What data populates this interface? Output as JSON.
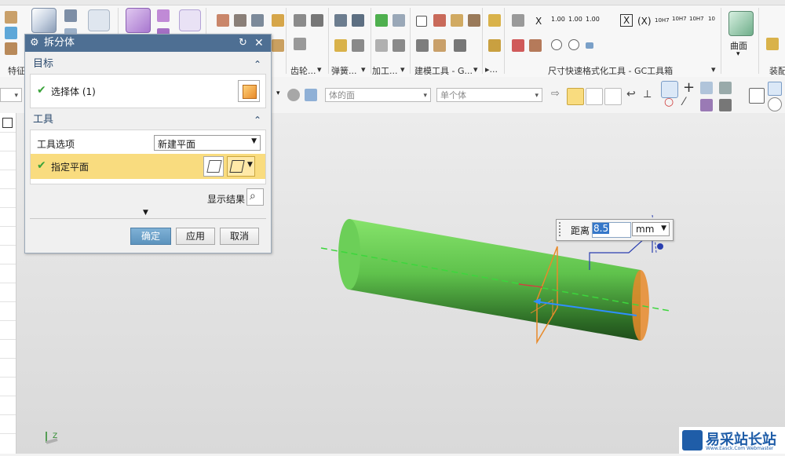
{
  "ribbon": {
    "group_labels": {
      "feature": "特征",
      "gear": "齿轮...",
      "spring": "弹簧...",
      "machining": "加工...",
      "modeling_tools": "建模工具 - G...",
      "more": "▸...",
      "dimension_format": "尺寸快速格式化工具 - GC工具箱",
      "surface": "曲面",
      "assembly": "装配"
    },
    "dim_icons": [
      "X",
      "1.00",
      "1.00",
      "1.00",
      "X",
      "(X)",
      "10H7",
      "10H7",
      "10H7",
      "10"
    ]
  },
  "selection_bar": {
    "face_filter": "体的面",
    "body_filter": "单个体"
  },
  "dialog": {
    "title": "拆分体",
    "target": {
      "header": "目标",
      "select_body_label": "选择体 (1)"
    },
    "tool": {
      "header": "工具",
      "tool_option_label": "工具选项",
      "tool_option_value": "新建平面",
      "specify_plane_label": "指定平面"
    },
    "show_result_label": "显示结果",
    "buttons": {
      "ok": "确定",
      "apply": "应用",
      "cancel": "取消"
    }
  },
  "distance_input": {
    "label": "距离",
    "value": "8.5",
    "unit": "mm"
  },
  "watermark": {
    "text": "易采站长站",
    "subtext": "Www.Easck.Com  Webmaster"
  },
  "colors": {
    "dialog_title_bar": "#4e6f93",
    "highlight_row": "#f9dc7f",
    "check_green": "#3aa33a",
    "cylinder_green": "#6fd35a",
    "plane_orange": "#e88a2a",
    "axis_green": "#3cd63c",
    "ok_button": "#5c93bd"
  }
}
